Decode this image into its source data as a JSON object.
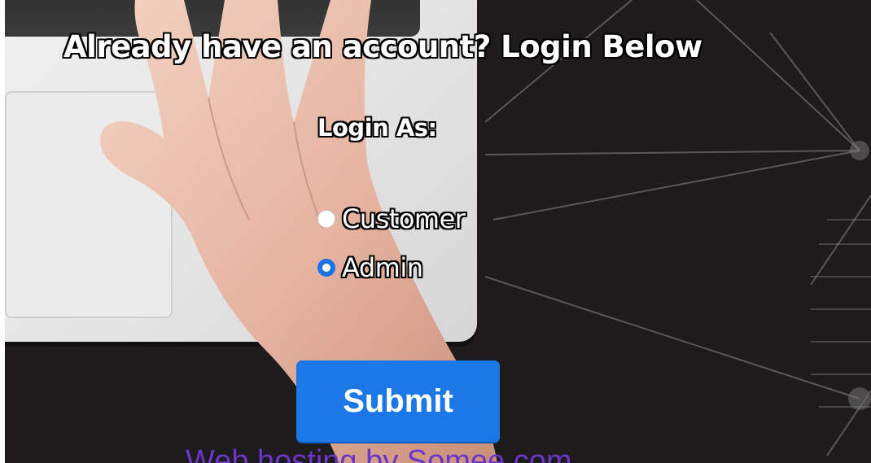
{
  "page": {
    "heading": "Already have an account? Login Below",
    "login_as_label": "Login As:"
  },
  "role_options": [
    {
      "label": "Customer",
      "selected": false
    },
    {
      "label": "Admin",
      "selected": true
    }
  ],
  "submit": {
    "label": "Submit"
  },
  "footer": {
    "link_text": "Web hosting by Somee.com"
  },
  "colors": {
    "primary": "#1b78e6",
    "radio_selected": "#1a73e8",
    "footer_link": "#6a35c9",
    "background_dark": "#1e1b1c"
  }
}
